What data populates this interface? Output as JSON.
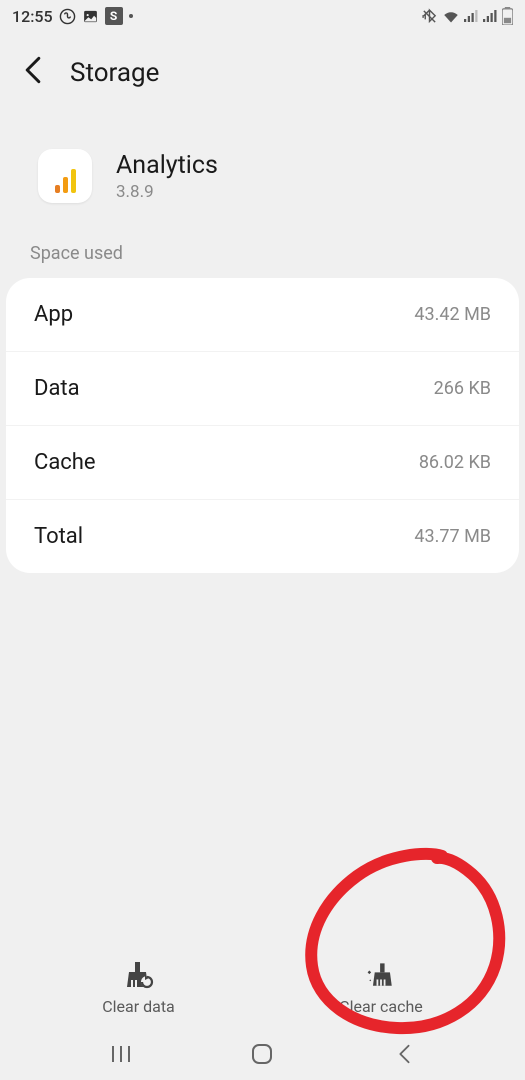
{
  "status": {
    "time": "12:55"
  },
  "header": {
    "title": "Storage"
  },
  "app": {
    "name": "Analytics",
    "version": "3.8.9"
  },
  "section": {
    "space_used_label": "Space used"
  },
  "rows": {
    "app_label": "App",
    "app_value": "43.42 MB",
    "data_label": "Data",
    "data_value": "266 KB",
    "cache_label": "Cache",
    "cache_value": "86.02 KB",
    "total_label": "Total",
    "total_value": "43.77 MB"
  },
  "actions": {
    "clear_data": "Clear data",
    "clear_cache": "Clear cache"
  }
}
